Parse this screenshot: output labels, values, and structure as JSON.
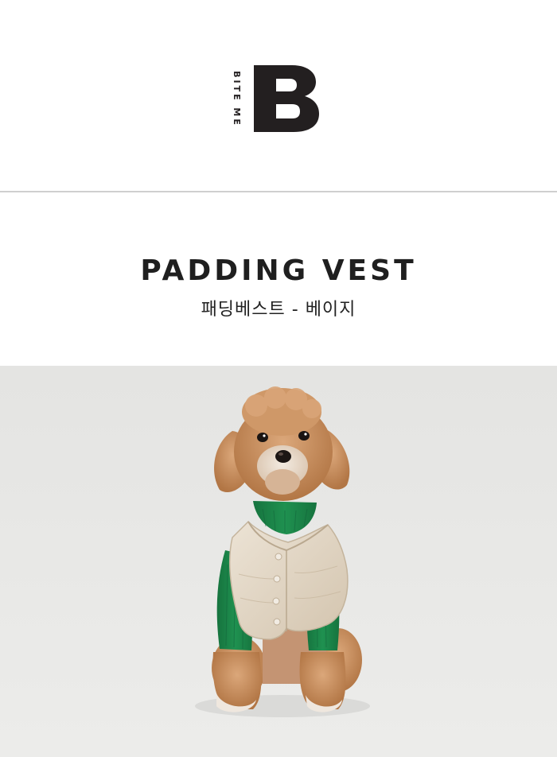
{
  "brand": {
    "name": "BITE ME",
    "monogram": "B",
    "color": "#231f20"
  },
  "product": {
    "title": "PADDING VEST",
    "subtitle": "패딩베스트 - 베이지"
  },
  "photo": {
    "subject": "dog-wearing-beige-padding-vest-icon",
    "background": "#e7e7e5",
    "colors": {
      "vest": "#e2d6c4",
      "turtleneck": "#1f8a4d",
      "fur": "#c48a57"
    }
  }
}
